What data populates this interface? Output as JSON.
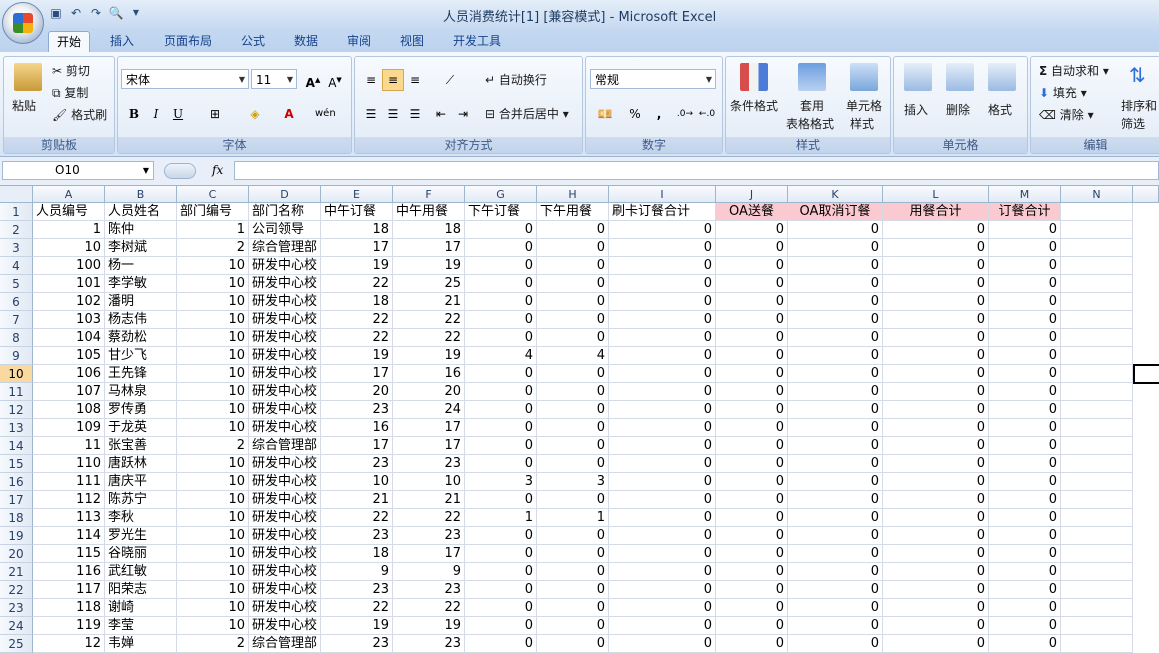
{
  "window": {
    "title": "人员消费统计[1]  [兼容模式] - Microsoft Excel"
  },
  "qat_icons": [
    "save-icon",
    "undo-icon",
    "redo-icon",
    "print-preview-icon",
    "customize-icon"
  ],
  "tabs": [
    "开始",
    "插入",
    "页面布局",
    "公式",
    "数据",
    "审阅",
    "视图",
    "开发工具"
  ],
  "clipboard": {
    "paste": "粘贴",
    "cut": "剪切",
    "copy": "复制",
    "format_painter": "格式刷",
    "label": "剪贴板"
  },
  "font": {
    "name": "宋体",
    "size": "11",
    "bold": "B",
    "italic": "I",
    "underline": "U",
    "label": "字体"
  },
  "alignment": {
    "wrap": "自动换行",
    "merge": "合并后居中",
    "label": "对齐方式"
  },
  "number": {
    "format": "常规",
    "percent": "%",
    "comma": ",",
    "label": "数字"
  },
  "styles": {
    "conditional": "条件格式",
    "table_fmt_1": "套用",
    "table_fmt_2": "表格格式",
    "cell_style_1": "单元格",
    "cell_style_2": "样式",
    "label": "样式"
  },
  "cells": {
    "insert": "插入",
    "delete": "删除",
    "format": "格式",
    "label": "单元格"
  },
  "editing": {
    "autosum": "自动求和",
    "fill": "填充",
    "clear": "清除",
    "sort_1": "排序和",
    "sort_2": "筛选",
    "label": "编辑"
  },
  "formula_bar": {
    "name_box": "O10",
    "fx": "fx",
    "content": ""
  },
  "columns": [
    "A",
    "B",
    "C",
    "D",
    "E",
    "F",
    "G",
    "H",
    "I",
    "J",
    "K",
    "L",
    "M",
    "N"
  ],
  "header_row": [
    "人员编号",
    "人员姓名",
    "部门编号",
    "部门名称",
    "中午订餐",
    "中午用餐",
    "下午订餐",
    "下午用餐",
    "刷卡订餐合计",
    "OA送餐",
    "OA取消订餐",
    "用餐合计",
    "订餐合计"
  ],
  "highlight_color": "#fbc9d0",
  "selected_row": "10",
  "rows": [
    [
      "2",
      "1",
      "陈仲",
      "1",
      "公司领导",
      "18",
      "18",
      "0",
      "0",
      "0",
      "0",
      "0",
      "0",
      "0"
    ],
    [
      "3",
      "10",
      "李树斌",
      "2",
      "综合管理部",
      "17",
      "17",
      "0",
      "0",
      "0",
      "0",
      "0",
      "0",
      "0"
    ],
    [
      "4",
      "100",
      "杨一",
      "10",
      "研发中心校",
      "19",
      "19",
      "0",
      "0",
      "0",
      "0",
      "0",
      "0",
      "0"
    ],
    [
      "5",
      "101",
      "李学敏",
      "10",
      "研发中心校",
      "22",
      "25",
      "0",
      "0",
      "0",
      "0",
      "0",
      "0",
      "0"
    ],
    [
      "6",
      "102",
      "潘明",
      "10",
      "研发中心校",
      "18",
      "21",
      "0",
      "0",
      "0",
      "0",
      "0",
      "0",
      "0"
    ],
    [
      "7",
      "103",
      "杨志伟",
      "10",
      "研发中心校",
      "22",
      "22",
      "0",
      "0",
      "0",
      "0",
      "0",
      "0",
      "0"
    ],
    [
      "8",
      "104",
      "蔡劲松",
      "10",
      "研发中心校",
      "22",
      "22",
      "0",
      "0",
      "0",
      "0",
      "0",
      "0",
      "0"
    ],
    [
      "9",
      "105",
      "甘少飞",
      "10",
      "研发中心校",
      "19",
      "19",
      "4",
      "4",
      "0",
      "0",
      "0",
      "0",
      "0"
    ],
    [
      "10",
      "106",
      "王先锋",
      "10",
      "研发中心校",
      "17",
      "16",
      "0",
      "0",
      "0",
      "0",
      "0",
      "0",
      "0"
    ],
    [
      "11",
      "107",
      "马林泉",
      "10",
      "研发中心校",
      "20",
      "20",
      "0",
      "0",
      "0",
      "0",
      "0",
      "0",
      "0"
    ],
    [
      "12",
      "108",
      "罗传勇",
      "10",
      "研发中心校",
      "23",
      "24",
      "0",
      "0",
      "0",
      "0",
      "0",
      "0",
      "0"
    ],
    [
      "13",
      "109",
      "于龙英",
      "10",
      "研发中心校",
      "16",
      "17",
      "0",
      "0",
      "0",
      "0",
      "0",
      "0",
      "0"
    ],
    [
      "14",
      "11",
      "张宝善",
      "2",
      "综合管理部",
      "17",
      "17",
      "0",
      "0",
      "0",
      "0",
      "0",
      "0",
      "0"
    ],
    [
      "15",
      "110",
      "唐跃林",
      "10",
      "研发中心校",
      "23",
      "23",
      "0",
      "0",
      "0",
      "0",
      "0",
      "0",
      "0"
    ],
    [
      "16",
      "111",
      "唐庆平",
      "10",
      "研发中心校",
      "10",
      "10",
      "3",
      "3",
      "0",
      "0",
      "0",
      "0",
      "0"
    ],
    [
      "17",
      "112",
      "陈苏宁",
      "10",
      "研发中心校",
      "21",
      "21",
      "0",
      "0",
      "0",
      "0",
      "0",
      "0",
      "0"
    ],
    [
      "18",
      "113",
      "李秋",
      "10",
      "研发中心校",
      "22",
      "22",
      "1",
      "1",
      "0",
      "0",
      "0",
      "0",
      "0"
    ],
    [
      "19",
      "114",
      "罗光生",
      "10",
      "研发中心校",
      "23",
      "23",
      "0",
      "0",
      "0",
      "0",
      "0",
      "0",
      "0"
    ],
    [
      "20",
      "115",
      "谷晓丽",
      "10",
      "研发中心校",
      "18",
      "17",
      "0",
      "0",
      "0",
      "0",
      "0",
      "0",
      "0"
    ],
    [
      "21",
      "116",
      "武红敏",
      "10",
      "研发中心校",
      "9",
      "9",
      "0",
      "0",
      "0",
      "0",
      "0",
      "0",
      "0"
    ],
    [
      "22",
      "117",
      "阳荣志",
      "10",
      "研发中心校",
      "23",
      "23",
      "0",
      "0",
      "0",
      "0",
      "0",
      "0",
      "0"
    ],
    [
      "23",
      "118",
      "谢崎",
      "10",
      "研发中心校",
      "22",
      "22",
      "0",
      "0",
      "0",
      "0",
      "0",
      "0",
      "0"
    ],
    [
      "24",
      "119",
      "李莹",
      "10",
      "研发中心校",
      "19",
      "19",
      "0",
      "0",
      "0",
      "0",
      "0",
      "0",
      "0"
    ],
    [
      "25",
      "12",
      "韦婵",
      "2",
      "综合管理部",
      "23",
      "23",
      "0",
      "0",
      "0",
      "0",
      "0",
      "0",
      "0"
    ]
  ]
}
